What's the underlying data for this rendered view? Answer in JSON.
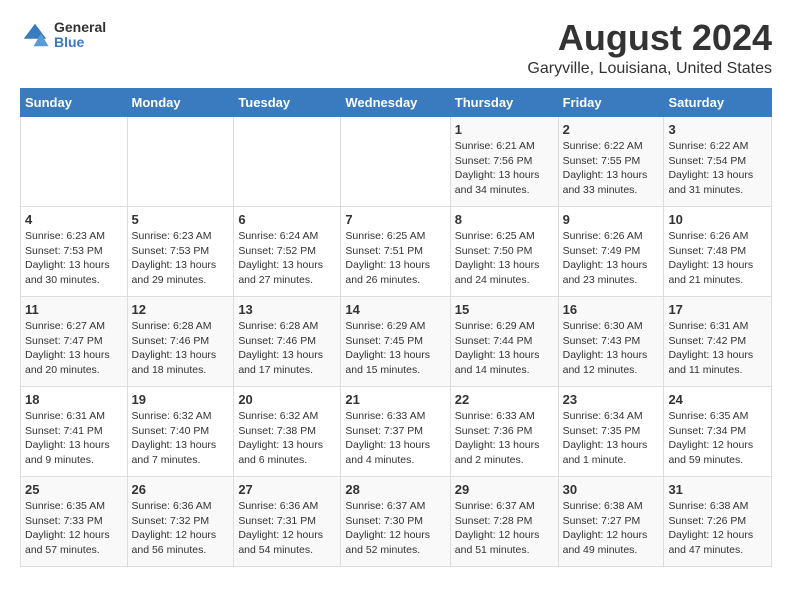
{
  "logo": {
    "general": "General",
    "blue": "Blue"
  },
  "title": "August 2024",
  "location": "Garyville, Louisiana, United States",
  "days_of_week": [
    "Sunday",
    "Monday",
    "Tuesday",
    "Wednesday",
    "Thursday",
    "Friday",
    "Saturday"
  ],
  "weeks": [
    [
      {
        "day": "",
        "content": ""
      },
      {
        "day": "",
        "content": ""
      },
      {
        "day": "",
        "content": ""
      },
      {
        "day": "",
        "content": ""
      },
      {
        "day": "1",
        "content": "Sunrise: 6:21 AM\nSunset: 7:56 PM\nDaylight: 13 hours\nand 34 minutes."
      },
      {
        "day": "2",
        "content": "Sunrise: 6:22 AM\nSunset: 7:55 PM\nDaylight: 13 hours\nand 33 minutes."
      },
      {
        "day": "3",
        "content": "Sunrise: 6:22 AM\nSunset: 7:54 PM\nDaylight: 13 hours\nand 31 minutes."
      }
    ],
    [
      {
        "day": "4",
        "content": "Sunrise: 6:23 AM\nSunset: 7:53 PM\nDaylight: 13 hours\nand 30 minutes."
      },
      {
        "day": "5",
        "content": "Sunrise: 6:23 AM\nSunset: 7:53 PM\nDaylight: 13 hours\nand 29 minutes."
      },
      {
        "day": "6",
        "content": "Sunrise: 6:24 AM\nSunset: 7:52 PM\nDaylight: 13 hours\nand 27 minutes."
      },
      {
        "day": "7",
        "content": "Sunrise: 6:25 AM\nSunset: 7:51 PM\nDaylight: 13 hours\nand 26 minutes."
      },
      {
        "day": "8",
        "content": "Sunrise: 6:25 AM\nSunset: 7:50 PM\nDaylight: 13 hours\nand 24 minutes."
      },
      {
        "day": "9",
        "content": "Sunrise: 6:26 AM\nSunset: 7:49 PM\nDaylight: 13 hours\nand 23 minutes."
      },
      {
        "day": "10",
        "content": "Sunrise: 6:26 AM\nSunset: 7:48 PM\nDaylight: 13 hours\nand 21 minutes."
      }
    ],
    [
      {
        "day": "11",
        "content": "Sunrise: 6:27 AM\nSunset: 7:47 PM\nDaylight: 13 hours\nand 20 minutes."
      },
      {
        "day": "12",
        "content": "Sunrise: 6:28 AM\nSunset: 7:46 PM\nDaylight: 13 hours\nand 18 minutes."
      },
      {
        "day": "13",
        "content": "Sunrise: 6:28 AM\nSunset: 7:46 PM\nDaylight: 13 hours\nand 17 minutes."
      },
      {
        "day": "14",
        "content": "Sunrise: 6:29 AM\nSunset: 7:45 PM\nDaylight: 13 hours\nand 15 minutes."
      },
      {
        "day": "15",
        "content": "Sunrise: 6:29 AM\nSunset: 7:44 PM\nDaylight: 13 hours\nand 14 minutes."
      },
      {
        "day": "16",
        "content": "Sunrise: 6:30 AM\nSunset: 7:43 PM\nDaylight: 13 hours\nand 12 minutes."
      },
      {
        "day": "17",
        "content": "Sunrise: 6:31 AM\nSunset: 7:42 PM\nDaylight: 13 hours\nand 11 minutes."
      }
    ],
    [
      {
        "day": "18",
        "content": "Sunrise: 6:31 AM\nSunset: 7:41 PM\nDaylight: 13 hours\nand 9 minutes."
      },
      {
        "day": "19",
        "content": "Sunrise: 6:32 AM\nSunset: 7:40 PM\nDaylight: 13 hours\nand 7 minutes."
      },
      {
        "day": "20",
        "content": "Sunrise: 6:32 AM\nSunset: 7:38 PM\nDaylight: 13 hours\nand 6 minutes."
      },
      {
        "day": "21",
        "content": "Sunrise: 6:33 AM\nSunset: 7:37 PM\nDaylight: 13 hours\nand 4 minutes."
      },
      {
        "day": "22",
        "content": "Sunrise: 6:33 AM\nSunset: 7:36 PM\nDaylight: 13 hours\nand 2 minutes."
      },
      {
        "day": "23",
        "content": "Sunrise: 6:34 AM\nSunset: 7:35 PM\nDaylight: 13 hours\nand 1 minute."
      },
      {
        "day": "24",
        "content": "Sunrise: 6:35 AM\nSunset: 7:34 PM\nDaylight: 12 hours\nand 59 minutes."
      }
    ],
    [
      {
        "day": "25",
        "content": "Sunrise: 6:35 AM\nSunset: 7:33 PM\nDaylight: 12 hours\nand 57 minutes."
      },
      {
        "day": "26",
        "content": "Sunrise: 6:36 AM\nSunset: 7:32 PM\nDaylight: 12 hours\nand 56 minutes."
      },
      {
        "day": "27",
        "content": "Sunrise: 6:36 AM\nSunset: 7:31 PM\nDaylight: 12 hours\nand 54 minutes."
      },
      {
        "day": "28",
        "content": "Sunrise: 6:37 AM\nSunset: 7:30 PM\nDaylight: 12 hours\nand 52 minutes."
      },
      {
        "day": "29",
        "content": "Sunrise: 6:37 AM\nSunset: 7:28 PM\nDaylight: 12 hours\nand 51 minutes."
      },
      {
        "day": "30",
        "content": "Sunrise: 6:38 AM\nSunset: 7:27 PM\nDaylight: 12 hours\nand 49 minutes."
      },
      {
        "day": "31",
        "content": "Sunrise: 6:38 AM\nSunset: 7:26 PM\nDaylight: 12 hours\nand 47 minutes."
      }
    ]
  ]
}
